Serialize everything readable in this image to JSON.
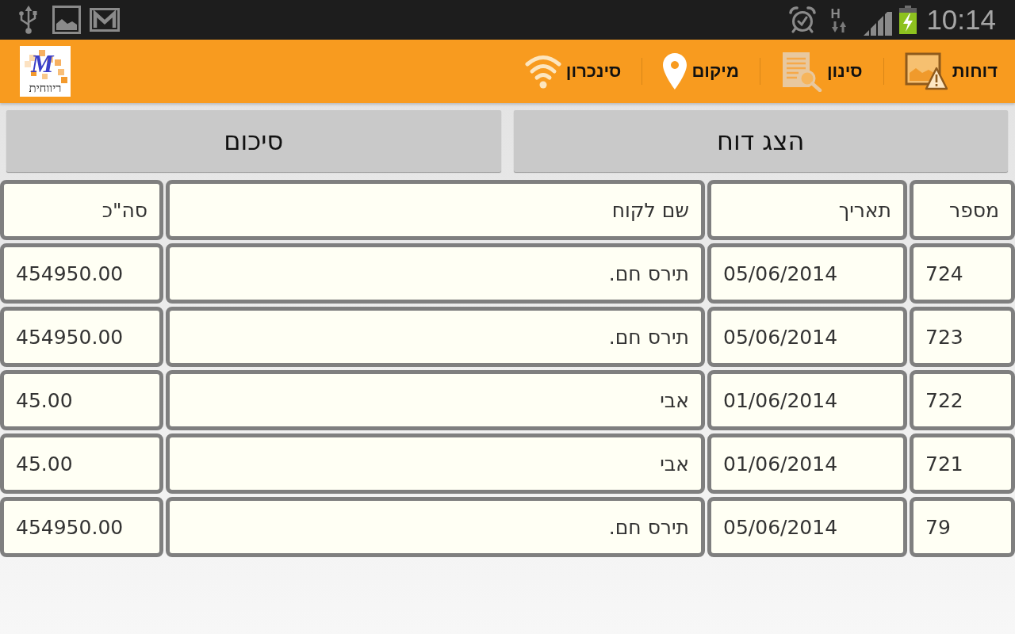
{
  "status_bar": {
    "network_type": "H",
    "time": "10:14"
  },
  "action_bar": {
    "logo": {
      "letter": "M",
      "text": "ריווחית"
    },
    "items": [
      {
        "label": "דוחות",
        "kind": "reports"
      },
      {
        "label": "סינון",
        "kind": "filter"
      },
      {
        "label": "מיקום",
        "kind": "location"
      },
      {
        "label": "סינכרון",
        "kind": "sync"
      }
    ]
  },
  "buttons": [
    "הצג דוח",
    "סיכום"
  ],
  "table": {
    "columns": [
      "מספר",
      "תאריך",
      "שם לקוח",
      "סה\"כ"
    ],
    "rows": [
      [
        "724",
        "05/06/2014",
        "תירס חם.",
        "454950.00"
      ],
      [
        "723",
        "05/06/2014",
        "תירס חם.",
        "454950.00"
      ],
      [
        "722",
        "01/06/2014",
        "אבי",
        "45.00"
      ],
      [
        "721",
        "01/06/2014",
        "אבי",
        "45.00"
      ],
      [
        "79",
        "05/06/2014",
        "תירס חם.",
        "454950.00"
      ]
    ]
  }
}
